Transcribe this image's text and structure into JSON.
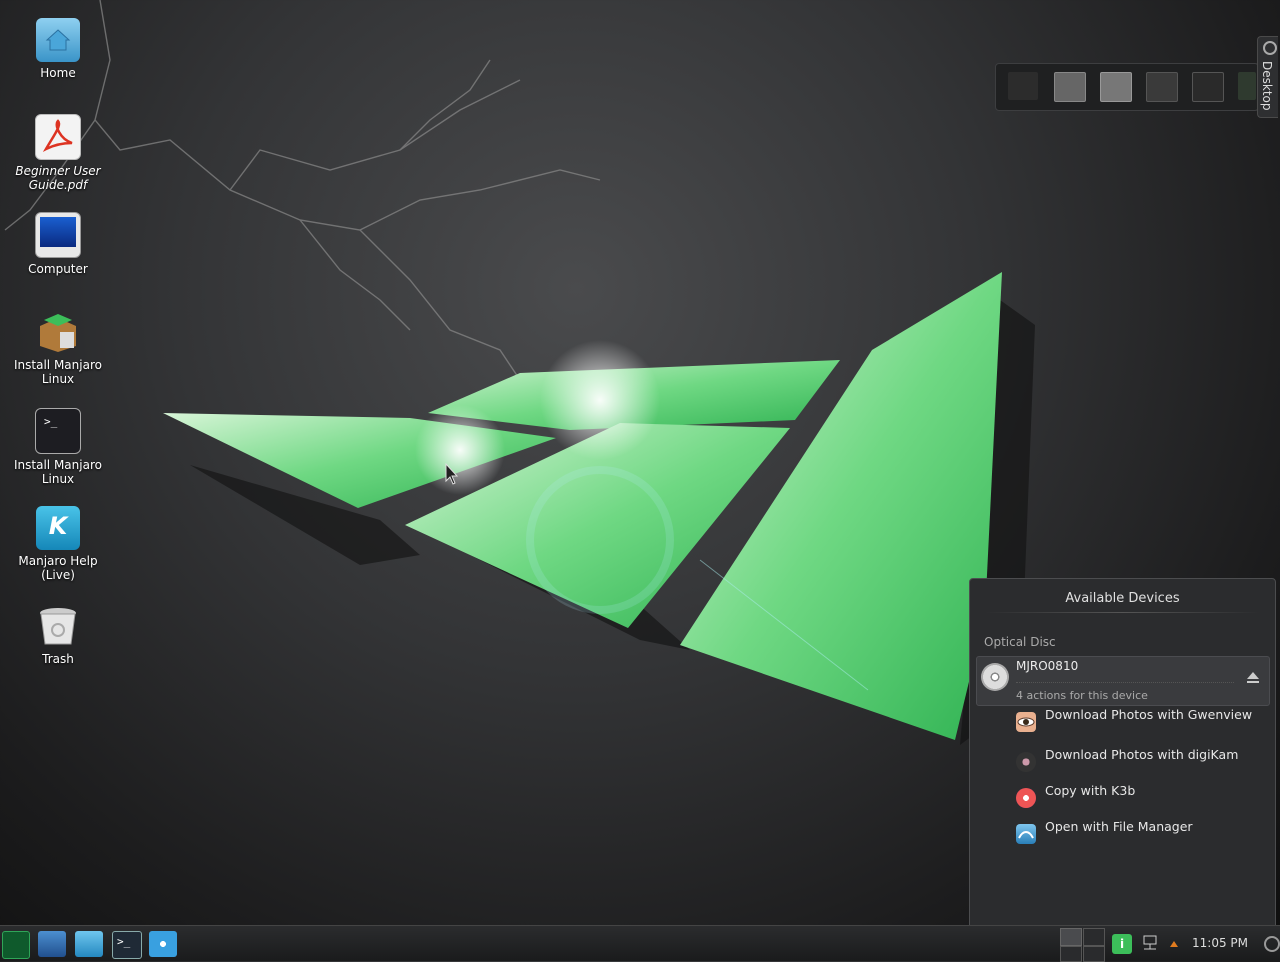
{
  "desktop_icons": [
    {
      "label": "Home",
      "icon": "home-folder-icon"
    },
    {
      "label": "Beginner User Guide.pdf",
      "icon": "pdf-icon"
    },
    {
      "label": "Computer",
      "icon": "computer-icon"
    },
    {
      "label": "Install Manjaro Linux",
      "icon": "installer-package-icon"
    },
    {
      "label": "Install Manjaro Linux",
      "icon": "terminal-icon"
    },
    {
      "label": "Manjaro Help (Live)",
      "icon": "help-icon"
    },
    {
      "label": "Trash",
      "icon": "trash-icon"
    }
  ],
  "toolbox": {
    "label": "Desktop"
  },
  "devices_popup": {
    "title": "Available Devices",
    "category": "Optical Disc",
    "device": {
      "name": "MJRO0810",
      "subtitle": "4 actions for this device",
      "icon": "optical-disc-icon"
    },
    "actions": [
      {
        "label": "Download Photos with Gwenview",
        "icon": "gwenview-icon"
      },
      {
        "label": "Download Photos with digiKam",
        "icon": "digikam-icon"
      },
      {
        "label": "Copy with K3b",
        "icon": "k3b-icon"
      },
      {
        "label": "Open with File Manager",
        "icon": "file-manager-icon"
      }
    ]
  },
  "panel": {
    "clock": "11:05 PM",
    "launchers": [
      "app-menu-icon",
      "system-settings-icon",
      "dolphin-icon",
      "konsole-icon",
      "browser-icon"
    ]
  },
  "colors": {
    "accent_green": "#3cbe5a",
    "panel_bg": "#232426",
    "popup_bg": "#2b2c2e"
  }
}
